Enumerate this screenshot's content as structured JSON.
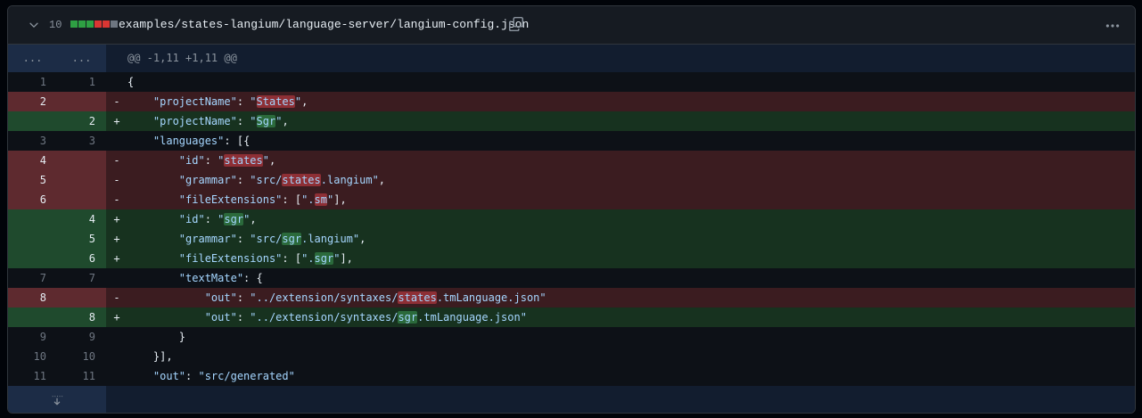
{
  "file": {
    "change_count": "10",
    "path": "examples/states-langium/language-server/langium-config.json",
    "diffstat": [
      "#2ea043",
      "#2ea043",
      "#2ea043",
      "#da3633",
      "#da3633",
      "#6e7681"
    ]
  },
  "hunk": {
    "left": "...",
    "right": "...",
    "header": "@@ -1,11 +1,11 @@"
  },
  "lines": [
    {
      "type": "ctx",
      "old": "1",
      "new": "1",
      "sign": "",
      "parts": [
        [
          "p",
          "{"
        ]
      ]
    },
    {
      "type": "del",
      "old": "2",
      "new": "",
      "sign": "-",
      "parts": [
        [
          "p",
          "    "
        ],
        [
          "k",
          "\"projectName\""
        ],
        [
          "p",
          ": "
        ],
        [
          "s",
          "\""
        ],
        [
          "hd",
          "States"
        ],
        [
          "s",
          "\""
        ],
        [
          "p",
          ","
        ]
      ]
    },
    {
      "type": "add",
      "old": "",
      "new": "2",
      "sign": "+",
      "parts": [
        [
          "p",
          "    "
        ],
        [
          "k",
          "\"projectName\""
        ],
        [
          "p",
          ": "
        ],
        [
          "s",
          "\""
        ],
        [
          "ha",
          "Sgr"
        ],
        [
          "s",
          "\""
        ],
        [
          "p",
          ","
        ]
      ]
    },
    {
      "type": "ctx",
      "old": "3",
      "new": "3",
      "sign": "",
      "parts": [
        [
          "p",
          "    "
        ],
        [
          "k",
          "\"languages\""
        ],
        [
          "p",
          ": [{"
        ]
      ]
    },
    {
      "type": "del",
      "old": "4",
      "new": "",
      "sign": "-",
      "parts": [
        [
          "p",
          "        "
        ],
        [
          "k",
          "\"id\""
        ],
        [
          "p",
          ": "
        ],
        [
          "s",
          "\""
        ],
        [
          "hd",
          "states"
        ],
        [
          "s",
          "\""
        ],
        [
          "p",
          ","
        ]
      ]
    },
    {
      "type": "del",
      "old": "5",
      "new": "",
      "sign": "-",
      "parts": [
        [
          "p",
          "        "
        ],
        [
          "k",
          "\"grammar\""
        ],
        [
          "p",
          ": "
        ],
        [
          "s",
          "\"src/"
        ],
        [
          "hd",
          "states"
        ],
        [
          "s",
          ".langium\""
        ],
        [
          "p",
          ","
        ]
      ]
    },
    {
      "type": "del",
      "old": "6",
      "new": "",
      "sign": "-",
      "parts": [
        [
          "p",
          "        "
        ],
        [
          "k",
          "\"fileExtensions\""
        ],
        [
          "p",
          ": ["
        ],
        [
          "s",
          "\"."
        ],
        [
          "hd",
          "sm"
        ],
        [
          "s",
          "\""
        ],
        [
          "p",
          "],"
        ]
      ]
    },
    {
      "type": "add",
      "old": "",
      "new": "4",
      "sign": "+",
      "parts": [
        [
          "p",
          "        "
        ],
        [
          "k",
          "\"id\""
        ],
        [
          "p",
          ": "
        ],
        [
          "s",
          "\""
        ],
        [
          "ha",
          "sgr"
        ],
        [
          "s",
          "\""
        ],
        [
          "p",
          ","
        ]
      ]
    },
    {
      "type": "add",
      "old": "",
      "new": "5",
      "sign": "+",
      "parts": [
        [
          "p",
          "        "
        ],
        [
          "k",
          "\"grammar\""
        ],
        [
          "p",
          ": "
        ],
        [
          "s",
          "\"src/"
        ],
        [
          "ha",
          "sgr"
        ],
        [
          "s",
          ".langium\""
        ],
        [
          "p",
          ","
        ]
      ]
    },
    {
      "type": "add",
      "old": "",
      "new": "6",
      "sign": "+",
      "parts": [
        [
          "p",
          "        "
        ],
        [
          "k",
          "\"fileExtensions\""
        ],
        [
          "p",
          ": ["
        ],
        [
          "s",
          "\"."
        ],
        [
          "ha",
          "sgr"
        ],
        [
          "s",
          "\""
        ],
        [
          "p",
          "],"
        ]
      ]
    },
    {
      "type": "ctx",
      "old": "7",
      "new": "7",
      "sign": "",
      "parts": [
        [
          "p",
          "        "
        ],
        [
          "k",
          "\"textMate\""
        ],
        [
          "p",
          ": {"
        ]
      ]
    },
    {
      "type": "del",
      "old": "8",
      "new": "",
      "sign": "-",
      "parts": [
        [
          "p",
          "            "
        ],
        [
          "k",
          "\"out\""
        ],
        [
          "p",
          ": "
        ],
        [
          "s",
          "\"../extension/syntaxes/"
        ],
        [
          "hd",
          "states"
        ],
        [
          "s",
          ".tmLanguage.json\""
        ]
      ]
    },
    {
      "type": "add",
      "old": "",
      "new": "8",
      "sign": "+",
      "parts": [
        [
          "p",
          "            "
        ],
        [
          "k",
          "\"out\""
        ],
        [
          "p",
          ": "
        ],
        [
          "s",
          "\"../extension/syntaxes/"
        ],
        [
          "ha",
          "sgr"
        ],
        [
          "s",
          ".tmLanguage.json\""
        ]
      ]
    },
    {
      "type": "ctx",
      "old": "9",
      "new": "9",
      "sign": "",
      "parts": [
        [
          "p",
          "        }"
        ]
      ]
    },
    {
      "type": "ctx",
      "old": "10",
      "new": "10",
      "sign": "",
      "parts": [
        [
          "p",
          "    }],"
        ]
      ]
    },
    {
      "type": "ctx",
      "old": "11",
      "new": "11",
      "sign": "",
      "parts": [
        [
          "p",
          "    "
        ],
        [
          "k",
          "\"out\""
        ],
        [
          "p",
          ": "
        ],
        [
          "s",
          "\"src/generated\""
        ]
      ]
    }
  ],
  "colors": {
    "added": "#2ea043",
    "removed": "#da3633",
    "neutral": "#6e7681"
  },
  "icons": [
    "chevron-down-icon",
    "copy-icon",
    "kebab-horizontal-icon",
    "unfold-down-icon"
  ]
}
